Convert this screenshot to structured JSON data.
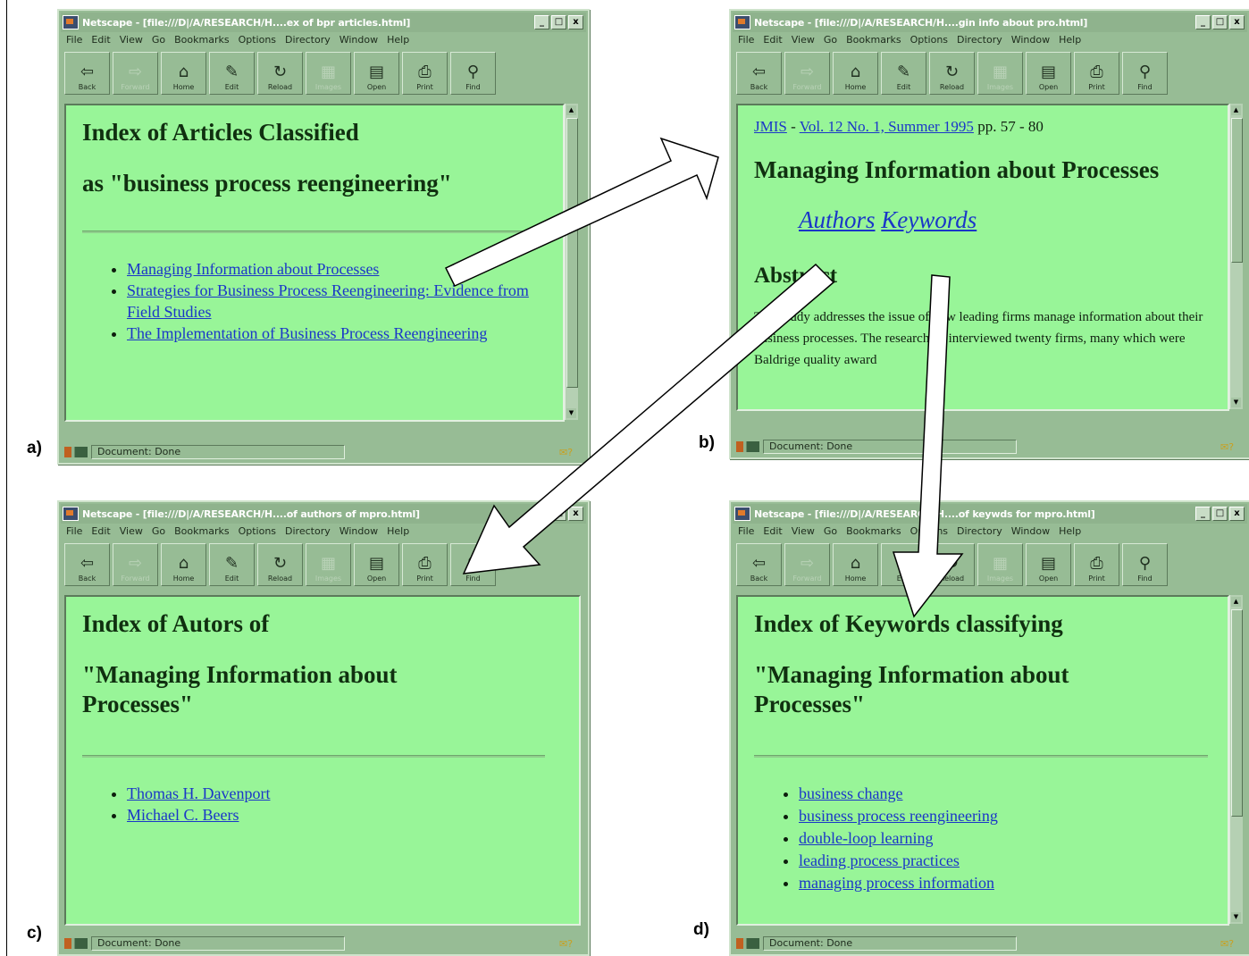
{
  "labels": {
    "a": "a)",
    "b": "b)",
    "c": "c)",
    "d": "d)"
  },
  "menu": [
    "File",
    "Edit",
    "View",
    "Go",
    "Bookmarks",
    "Options",
    "Directory",
    "Window",
    "Help"
  ],
  "toolbar": [
    {
      "label": "Back",
      "icon": "back-arrow-icon",
      "glyph": "⇦",
      "enabled": true
    },
    {
      "label": "Forward",
      "icon": "forward-arrow-icon",
      "glyph": "⇨",
      "enabled": false
    },
    {
      "label": "Home",
      "icon": "home-icon",
      "glyph": "⌂",
      "enabled": true
    },
    {
      "label": "Edit",
      "icon": "pencil-icon",
      "glyph": "✎",
      "enabled": true
    },
    {
      "label": "Reload",
      "icon": "reload-icon",
      "glyph": "↻",
      "enabled": true
    },
    {
      "label": "Images",
      "icon": "images-icon",
      "glyph": "▦",
      "enabled": false
    },
    {
      "label": "Open",
      "icon": "open-icon",
      "glyph": "▤",
      "enabled": true
    },
    {
      "label": "Print",
      "icon": "print-icon",
      "glyph": "⎙",
      "enabled": true
    },
    {
      "label": "Find",
      "icon": "binoculars-icon",
      "glyph": "⚲",
      "enabled": true
    }
  ],
  "window_buttons": {
    "minimize": "_",
    "maximize": "□",
    "close": "x"
  },
  "status": "Document: Done",
  "windows": {
    "a": {
      "title": "Netscape - [file:///D|/A/RESEARCH/H....ex of bpr articles.html]",
      "heading1": "Index of Articles Classified",
      "heading2": "as \"business process reengineering\"",
      "links": [
        "Managing Information about Processes",
        "Strategies for Business Process Reengineering: Evidence from Field Studies",
        "The Implementation of Business Process Reengineering"
      ]
    },
    "b": {
      "title": "Netscape - [file:///D|/A/RESEARCH/H....gin info about pro.html]",
      "journal": "JMIS",
      "separator": "-",
      "volume": "Vol. 12 No. 1, Summer 1995",
      "pages": "pp. 57 - 80",
      "heading": "Managing Information about Processes",
      "authors_link": "Authors",
      "keywords_link": "Keywords",
      "abstract_heading": "Abstract",
      "abstract_text": "This study addresses the issue of how leading firms manage information about their business processes. The researchers interviewed twenty firms, many which were Baldrige quality award"
    },
    "c": {
      "title": "Netscape - [file:///D|/A/RESEARCH/H....of authors of mpro.html]",
      "heading1": "Index of Autors of",
      "heading2": "\"Managing Information about Processes\"",
      "links": [
        "Thomas H. Davenport",
        "Michael C. Beers"
      ]
    },
    "d": {
      "title": "Netscape - [file:///D|/A/RESEARCH/H....of keywds for mpro.html]",
      "heading1": "Index of Keywords classifying",
      "heading2": "\"Managing Information about Processes\"",
      "links": [
        "business change",
        "business process reengineering",
        "double-loop learning",
        "leading process practices",
        "managing process information"
      ]
    }
  }
}
